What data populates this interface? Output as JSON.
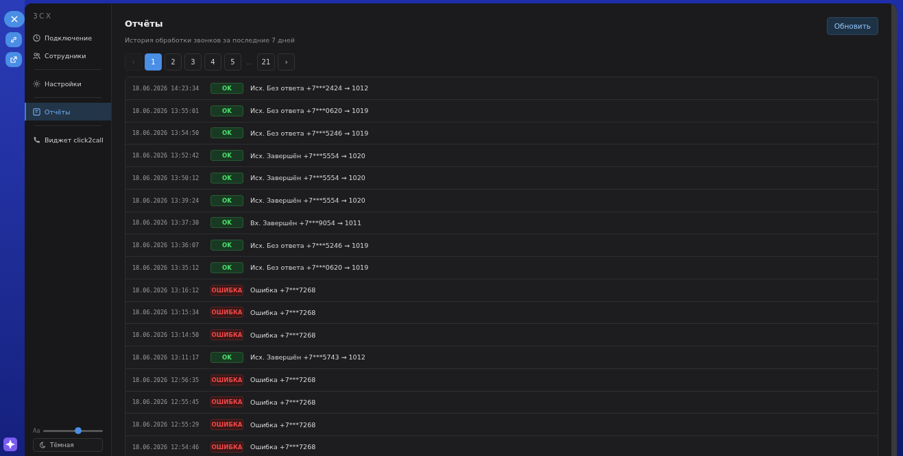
{
  "sidebar": {
    "brand": "3CX",
    "items": [
      {
        "label": "Подключение",
        "selected": false
      },
      {
        "label": "Сотрудники",
        "selected": false
      },
      {
        "label": "Настройки",
        "selected": false
      },
      {
        "label": "Отчёты",
        "selected": true
      },
      {
        "label": "Виджет click2call",
        "selected": false
      }
    ],
    "font_size": {
      "label": "Aa",
      "level": 0.59
    },
    "theme_button": "Тёмная"
  },
  "header": {
    "title": "Отчёты",
    "subtitle": "История обработки звонков за последние 7 дней",
    "refresh_button": "Обновить"
  },
  "pagination": {
    "prev": "‹",
    "next": "›",
    "ellipsis": "...",
    "pages": [
      {
        "label": "1",
        "selected": true
      },
      {
        "label": "2",
        "selected": false
      },
      {
        "label": "3",
        "selected": false
      },
      {
        "label": "4",
        "selected": false
      },
      {
        "label": "5",
        "selected": false
      },
      {
        "label": "21",
        "selected": false
      }
    ]
  },
  "rows": [
    {
      "time": "18.06.2026 14:23:34",
      "status": "OK",
      "kind": "ok",
      "text": "Исх. Без ответа +7***2424 → 1012"
    },
    {
      "time": "18.06.2026 13:55:01",
      "status": "OK",
      "kind": "ok",
      "text": "Исх. Без ответа +7***0620 → 1019"
    },
    {
      "time": "18.06.2026 13:54:50",
      "status": "OK",
      "kind": "ok",
      "text": "Исх. Без ответа +7***5246 → 1019"
    },
    {
      "time": "18.06.2026 13:52:42",
      "status": "OK",
      "kind": "ok",
      "text": "Исх. Завершён +7***5554 → 1020"
    },
    {
      "time": "18.06.2026 13:50:12",
      "status": "OK",
      "kind": "ok",
      "text": "Исх. Завершён +7***5554 → 1020"
    },
    {
      "time": "18.06.2026 13:39:24",
      "status": "OK",
      "kind": "ok",
      "text": "Исх. Завершён +7***5554 → 1020"
    },
    {
      "time": "18.06.2026 13:37:30",
      "status": "OK",
      "kind": "ok",
      "text": "Вх. Завершён +7***9054 → 1011"
    },
    {
      "time": "18.06.2026 13:36:07",
      "status": "OK",
      "kind": "ok",
      "text": "Исх. Без ответа +7***5246 → 1019"
    },
    {
      "time": "18.06.2026 13:35:12",
      "status": "OK",
      "kind": "ok",
      "text": "Исх. Без ответа +7***0620 → 1019"
    },
    {
      "time": "18.06.2026 13:16:12",
      "status": "ОШИБКА",
      "kind": "error",
      "text": "Ошибка +7***7268"
    },
    {
      "time": "18.06.2026 13:15:34",
      "status": "ОШИБКА",
      "kind": "error",
      "text": "Ошибка +7***7268"
    },
    {
      "time": "18.06.2026 13:14:50",
      "status": "ОШИБКА",
      "kind": "error",
      "text": "Ошибка +7***7268"
    },
    {
      "time": "18.06.2026 13:11:17",
      "status": "OK",
      "kind": "ok",
      "text": "Исх. Завершён +7***5743 → 1012"
    },
    {
      "time": "18.06.2026 12:56:35",
      "status": "ОШИБКА",
      "kind": "error",
      "text": "Ошибка +7***7268"
    },
    {
      "time": "18.06.2026 12:55:45",
      "status": "ОШИБКА",
      "kind": "error",
      "text": "Ошибка +7***7268"
    },
    {
      "time": "18.06.2026 12:55:29",
      "status": "ОШИБКА",
      "kind": "error",
      "text": "Ошибка +7***7268"
    },
    {
      "time": "18.06.2026 12:54:46",
      "status": "ОШИБКА",
      "kind": "error",
      "text": "Ошибка +7***7268"
    }
  ]
}
